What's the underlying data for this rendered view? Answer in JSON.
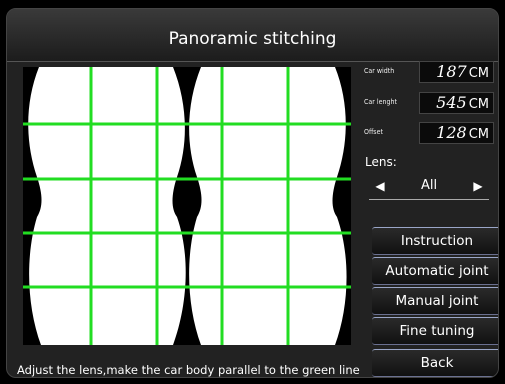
{
  "header": {
    "title": "Panoramic stitching"
  },
  "params": [
    {
      "label": "Car width",
      "value": "187",
      "unit": "CM"
    },
    {
      "label": "Car lenght",
      "value": "545",
      "unit": "CM"
    },
    {
      "label": "Offset",
      "value": "128",
      "unit": "CM"
    }
  ],
  "lens": {
    "label": "Lens:",
    "value": "All"
  },
  "buttons": {
    "instruction": "Instruction",
    "automatic_joint": "Automatic joint",
    "manual_joint": "Manual joint",
    "fine_tuning": "Fine tuning",
    "back": "Back"
  },
  "instruction_text": "Adjust the lens,make the car body parallel to the green line",
  "colors": {
    "guide_line": "#22dd22",
    "background": "#000000",
    "panel": "#222222"
  }
}
